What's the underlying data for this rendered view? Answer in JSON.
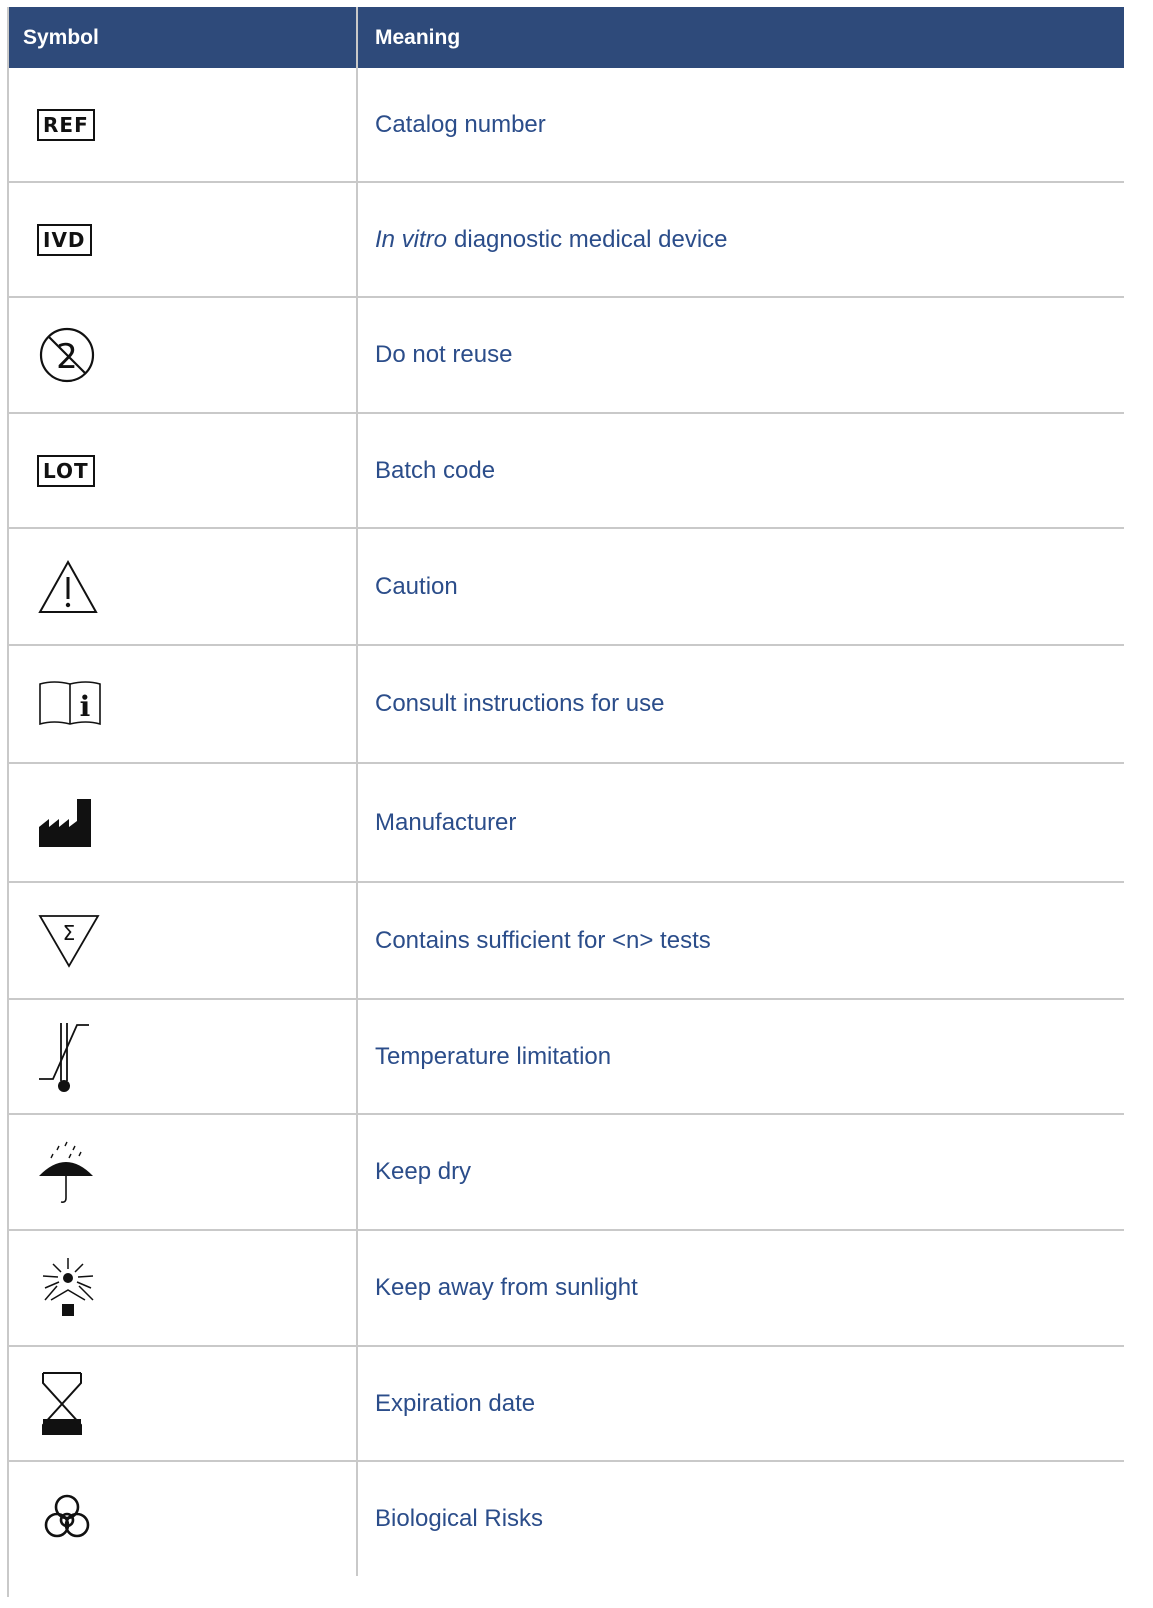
{
  "header": {
    "col1": "Symbol",
    "col2": "Meaning"
  },
  "rows": [
    {
      "icon": "ref-box-icon",
      "symbol_text": "REF",
      "meaning": "Catalog number"
    },
    {
      "icon": "ivd-box-icon",
      "symbol_text": "IVD",
      "meaning_italic": "In vitro",
      "meaning": "diagnostic medical device"
    },
    {
      "icon": "do-not-reuse-icon",
      "meaning": "Do not reuse"
    },
    {
      "icon": "lot-box-icon",
      "symbol_text": "LOT",
      "meaning": "Batch code"
    },
    {
      "icon": "caution-triangle-icon",
      "meaning": "Caution"
    },
    {
      "icon": "instructions-book-icon",
      "meaning": "Consult instructions for use"
    },
    {
      "icon": "factory-icon",
      "meaning": "Manufacturer"
    },
    {
      "icon": "sigma-triangle-icon",
      "meaning": "Contains sufficient for <n> tests"
    },
    {
      "icon": "thermometer-icon",
      "meaning": "Temperature limitation"
    },
    {
      "icon": "umbrella-rain-icon",
      "meaning": "Keep dry"
    },
    {
      "icon": "sunlight-icon",
      "meaning": "Keep away from sunlight"
    },
    {
      "icon": "hourglass-icon",
      "meaning": "Expiration date"
    },
    {
      "icon": "biohazard-icon",
      "meaning": "Biological Risks"
    }
  ],
  "colors": {
    "header_bg": "#2e4a7a",
    "text_blue": "#2b4d8a",
    "grid": "#c9c9c9"
  }
}
